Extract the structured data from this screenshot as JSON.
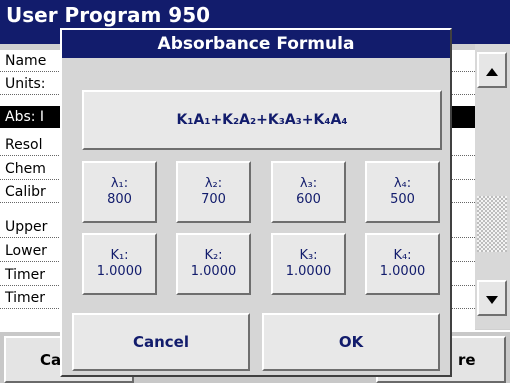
{
  "background": {
    "title": "User Program   950",
    "rows": [
      {
        "label": "Name"
      },
      {
        "label": "Units:"
      },
      {
        "label": "Abs: I",
        "selected": true
      },
      {
        "label": "Resol"
      },
      {
        "label": "Chem"
      },
      {
        "label": "Calibr"
      },
      {
        "label": "Upper"
      },
      {
        "label": "Lower"
      },
      {
        "label": "Timer"
      },
      {
        "label": "Timer"
      }
    ],
    "bottom_left_label": "Ca",
    "bottom_right_label": "re"
  },
  "dialog": {
    "title": "Absorbance Formula",
    "formula": "K₁A₁+K₂A₂+K₃A₃+K₄A₄",
    "wavelengths": [
      {
        "label": "λ₁:",
        "value": "800"
      },
      {
        "label": "λ₂:",
        "value": "700"
      },
      {
        "label": "λ₃:",
        "value": "600"
      },
      {
        "label": "λ₄:",
        "value": "500"
      }
    ],
    "factors": [
      {
        "label": "K₁:",
        "value": "1.0000"
      },
      {
        "label": "K₂:",
        "value": "1.0000"
      },
      {
        "label": "K₃:",
        "value": "1.0000"
      },
      {
        "label": "K₄:",
        "value": "1.0000"
      }
    ],
    "cancel_label": "Cancel",
    "ok_label": "OK"
  },
  "colors": {
    "title_bar": "#121c6c",
    "button_text": "#121c6c",
    "selected_row": "#000000"
  },
  "icons": {
    "scroll_up": "triangle-up-icon",
    "scroll_down": "triangle-down-icon"
  }
}
